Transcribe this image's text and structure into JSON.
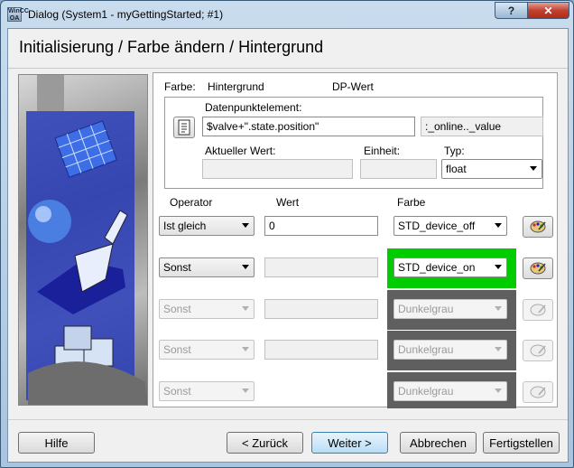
{
  "window": {
    "title": "Dialog (System1 - myGettingStarted; #1)",
    "app_icon_text": "WinCC OA",
    "help_glyph": "?",
    "close_glyph": "✕"
  },
  "header": {
    "title": "Initialisierung / Farbe ändern / Hintergrund"
  },
  "top_row": {
    "farbe_label": "Farbe:",
    "farbe_value": "Hintergrund",
    "dp_label": "DP-Wert"
  },
  "dp_group": {
    "element_label": "Datenpunktelement:",
    "element_value": "$valve+\".state.position\"",
    "config_value": ":_online.._value",
    "current_label": "Aktueller Wert:",
    "unit_label": "Einheit:",
    "type_label": "Typ:",
    "type_value": "float"
  },
  "columns": {
    "operator": "Operator",
    "wert": "Wert",
    "farbe": "Farbe"
  },
  "rows": [
    {
      "operator": "Ist gleich",
      "value": "0",
      "color": "STD_device_off",
      "enabled": true
    },
    {
      "operator": "Sonst",
      "value": "",
      "color": "STD_device_on",
      "enabled": true
    },
    {
      "operator": "Sonst",
      "value": "",
      "color": "Dunkelgrau",
      "enabled": false
    },
    {
      "operator": "Sonst",
      "value": "",
      "color": "Dunkelgrau",
      "enabled": false
    },
    {
      "operator": "Sonst",
      "value": "",
      "color": "Dunkelgrau",
      "enabled": false
    }
  ],
  "colors": {
    "std_device_off": "#ffffff",
    "std_device_on": "#00cc00",
    "dunkelgrau": "#5f5f5f"
  },
  "buttons": {
    "hilfe": "Hilfe",
    "zurueck": "< Zurück",
    "weiter": "Weiter >",
    "abbrechen": "Abbrechen",
    "fertigstellen": "Fertigstellen"
  }
}
